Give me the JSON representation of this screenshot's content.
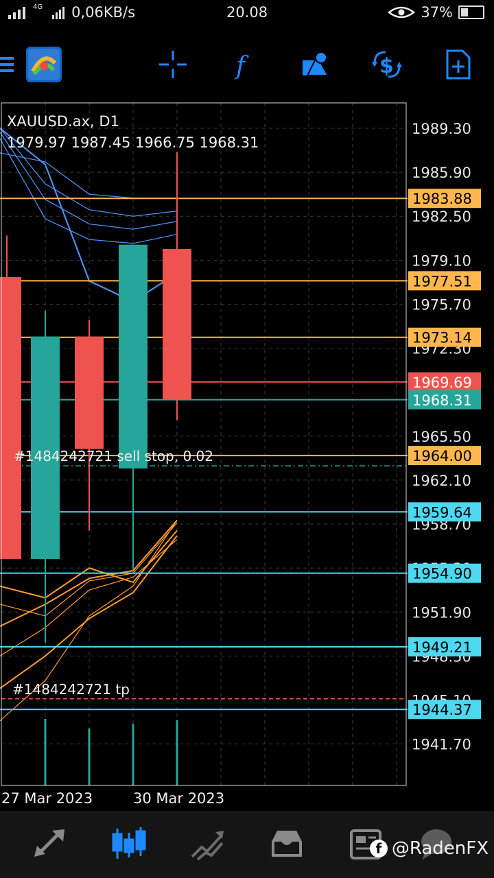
{
  "status_bar": {
    "signal": "4G",
    "speed": "0,06KB/s",
    "time": "20.08",
    "battery": "37%"
  },
  "toolbar": {
    "icons": [
      "menu-icon",
      "app-logo-icon",
      "crosshair-icon",
      "function-icon",
      "objects-icon",
      "trade-icon",
      "new-order-icon"
    ]
  },
  "chart": {
    "symbol_label": "XAUUSD.ax, D1",
    "ohlc_label": "1979.97 1987.45 1966.75 1968.31",
    "price_axis": [
      "1989.30",
      "1985.90",
      "1982.50",
      "1979.10",
      "1975.70",
      "1972.30",
      "1965.50",
      "1962.10",
      "1958.70",
      "1955.30",
      "1951.90",
      "1948.50",
      "1945.10",
      "1941.70"
    ],
    "date_labels": [
      "27 Mar 2023",
      "30 Mar 2023"
    ],
    "order_labels": {
      "sell_stop": "#1484242721 sell stop, 0.02",
      "tp": "#1484242721 tp"
    },
    "price_tags": [
      {
        "value": "1983.88",
        "color": "#ffb74d",
        "text_color": "#000000"
      },
      {
        "value": "1977.51",
        "color": "#ffb74d",
        "text_color": "#000000"
      },
      {
        "value": "1973.14",
        "color": "#ffb74d",
        "text_color": "#000000"
      },
      {
        "value": "1969.69",
        "color": "#ef5350",
        "text_color": "#ffffff"
      },
      {
        "value": "1968.31",
        "color": "#26a69a",
        "text_color": "#ffffff"
      },
      {
        "value": "1964.00",
        "color": "#ffb74d",
        "text_color": "#000000"
      },
      {
        "value": "1959.64",
        "color": "#4dd8f0",
        "text_color": "#000000"
      },
      {
        "value": "1954.90",
        "color": "#4dd8f0",
        "text_color": "#000000"
      },
      {
        "value": "1949.21",
        "color": "#4dd8f0",
        "text_color": "#000000"
      },
      {
        "value": "1944.37",
        "color": "#4dd8f0",
        "text_color": "#000000"
      }
    ],
    "colors": {
      "bull": "#26a69a",
      "bear": "#ef5350",
      "resistance": "#ffb74d",
      "support": "#4dd8f0",
      "upper_band": "#4d8ef0",
      "lower_band": "#ff9a2e"
    }
  },
  "chart_data": {
    "type": "candlestick",
    "x": [
      "2023-03-24",
      "2023-03-27",
      "2023-03-28",
      "2023-03-29",
      "2023-03-30"
    ],
    "candles": [
      {
        "open": 1977.8,
        "high": 1981.0,
        "low": 1956.0,
        "close": 1956.0
      },
      {
        "open": 1956.0,
        "high": 1975.2,
        "low": 1949.5,
        "close": 1973.2
      },
      {
        "open": 1973.2,
        "high": 1974.5,
        "low": 1958.2,
        "close": 1964.5
      },
      {
        "open": 1963.0,
        "high": 1980.3,
        "low": 1955.2,
        "close": 1980.3
      },
      {
        "open": 1979.97,
        "high": 1987.45,
        "low": 1966.75,
        "close": 1968.31
      }
    ],
    "volume_bars": 4
  },
  "bottom_nav": {
    "items": [
      "quotes-tab",
      "chart-tab",
      "trade-tab",
      "history-tab",
      "news-tab"
    ]
  },
  "watermark": {
    "text": "@RadenFX"
  }
}
